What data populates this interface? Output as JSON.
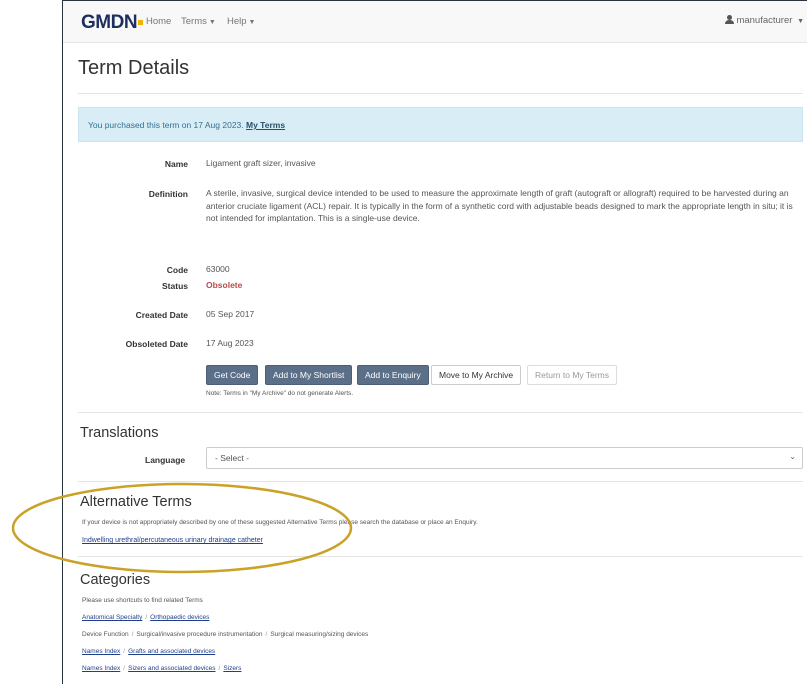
{
  "navbar": {
    "brand": "GMDN",
    "home": "Home",
    "terms": "Terms",
    "help": "Help",
    "user": "manufacturer"
  },
  "page_title": "Term Details",
  "alert": {
    "text": "You purchased this term on 17 Aug 2023. ",
    "link": "My Terms"
  },
  "details": {
    "name_label": "Name",
    "name_value": "Ligament graft sizer, invasive",
    "definition_label": "Definition",
    "definition_value": "A sterile, invasive, surgical device intended to be used to measure the approximate length of graft (autograft or allograft) required to be harvested during an anterior cruciate ligament (ACL) repair. It is typically in the form of a synthetic cord with adjustable beads designed to mark the appropriate length in situ; it is not intended for implantation. This is a single-use device.",
    "code_label": "Code",
    "code_value": "63000",
    "status_label": "Status",
    "status_value": "Obsolete",
    "created_label": "Created Date",
    "created_value": "05 Sep 2017",
    "obsoleted_label": "Obsoleted Date",
    "obsoleted_value": "17 Aug 2023"
  },
  "buttons": {
    "get_code": "Get Code",
    "add_shortlist": "Add to My Shortlist",
    "add_enquiry": "Add to Enquiry",
    "move_archive": "Move to My Archive",
    "return_terms": "Return to My Terms"
  },
  "note": "Note: Terms in \"My Archive\" do not generate Alerts.",
  "translations": {
    "heading": "Translations",
    "language_label": "Language",
    "select_value": "- Select -"
  },
  "alternative": {
    "heading": "Alternative Terms",
    "description": "If your device is not appropriately described by one of these suggested Alternative Terms please search the database or place an Enquiry.",
    "link": "Indwelling urethral/percutaneous urinary drainage catheter"
  },
  "categories": {
    "heading": "Categories",
    "description": "Please use shortcuts to find related Terms",
    "row1": [
      "Anatomical Specialty",
      "Orthopaedic devices"
    ],
    "row2": [
      "Device Function",
      "Surgical/invasive procedure instrumentation",
      "Surgical measuring/sizing devices"
    ],
    "row3": [
      "Names Index",
      "Grafts and associated devices"
    ],
    "row4": [
      "Names Index",
      "Sizers and associated devices",
      "Sizers"
    ]
  },
  "colors": {
    "annotation_ellipse": "#c9a227",
    "alert_bg": "#d9edf7",
    "primary_button": "#5b6f88",
    "obsolete": "#b94a48"
  }
}
